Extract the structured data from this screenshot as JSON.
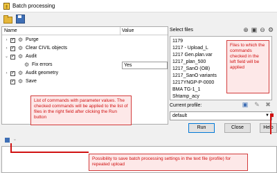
{
  "window": {
    "title": "Batch processing"
  },
  "toolbar": {
    "icons": [
      "open-folder-icon",
      "save-icon"
    ]
  },
  "tree": {
    "col_name": "Name",
    "col_value": "Value",
    "items": [
      {
        "label": "Purge",
        "checked": true
      },
      {
        "label": "Clear CIVIL objects",
        "checked": true
      },
      {
        "label": "Audit",
        "checked": true
      },
      {
        "label": "Fix errors",
        "value": "Yes"
      },
      {
        "label": "Audit geometry",
        "checked": true
      },
      {
        "label": "Save",
        "checked": true
      }
    ]
  },
  "files": {
    "label": "Select files",
    "items": [
      "1179",
      "1217 - Upload_L",
      "1217 Gen.plan.var",
      "1217_plan_500",
      "1217_SanO (OB)",
      "1217_SanO variants",
      "1217YNGP-P-0000",
      "BMA TG-1_1",
      "Shtamp_acy"
    ]
  },
  "profile": {
    "label": "Current profile:",
    "value": "default"
  },
  "buttons": {
    "run": "Run",
    "close": "Close",
    "help": "Help"
  },
  "annotations": {
    "left": "List of commands with parameter values. The checked commands will be applied to the list of files in the right field after clicking the Run button",
    "right": "Files to which the commands checked in the left field will be applied",
    "bottom": "Possibility to save batch processing settings in the text file (profile) for repeated upload"
  },
  "colors": {
    "annotation": "#d01010",
    "accent": "#0078d7"
  }
}
